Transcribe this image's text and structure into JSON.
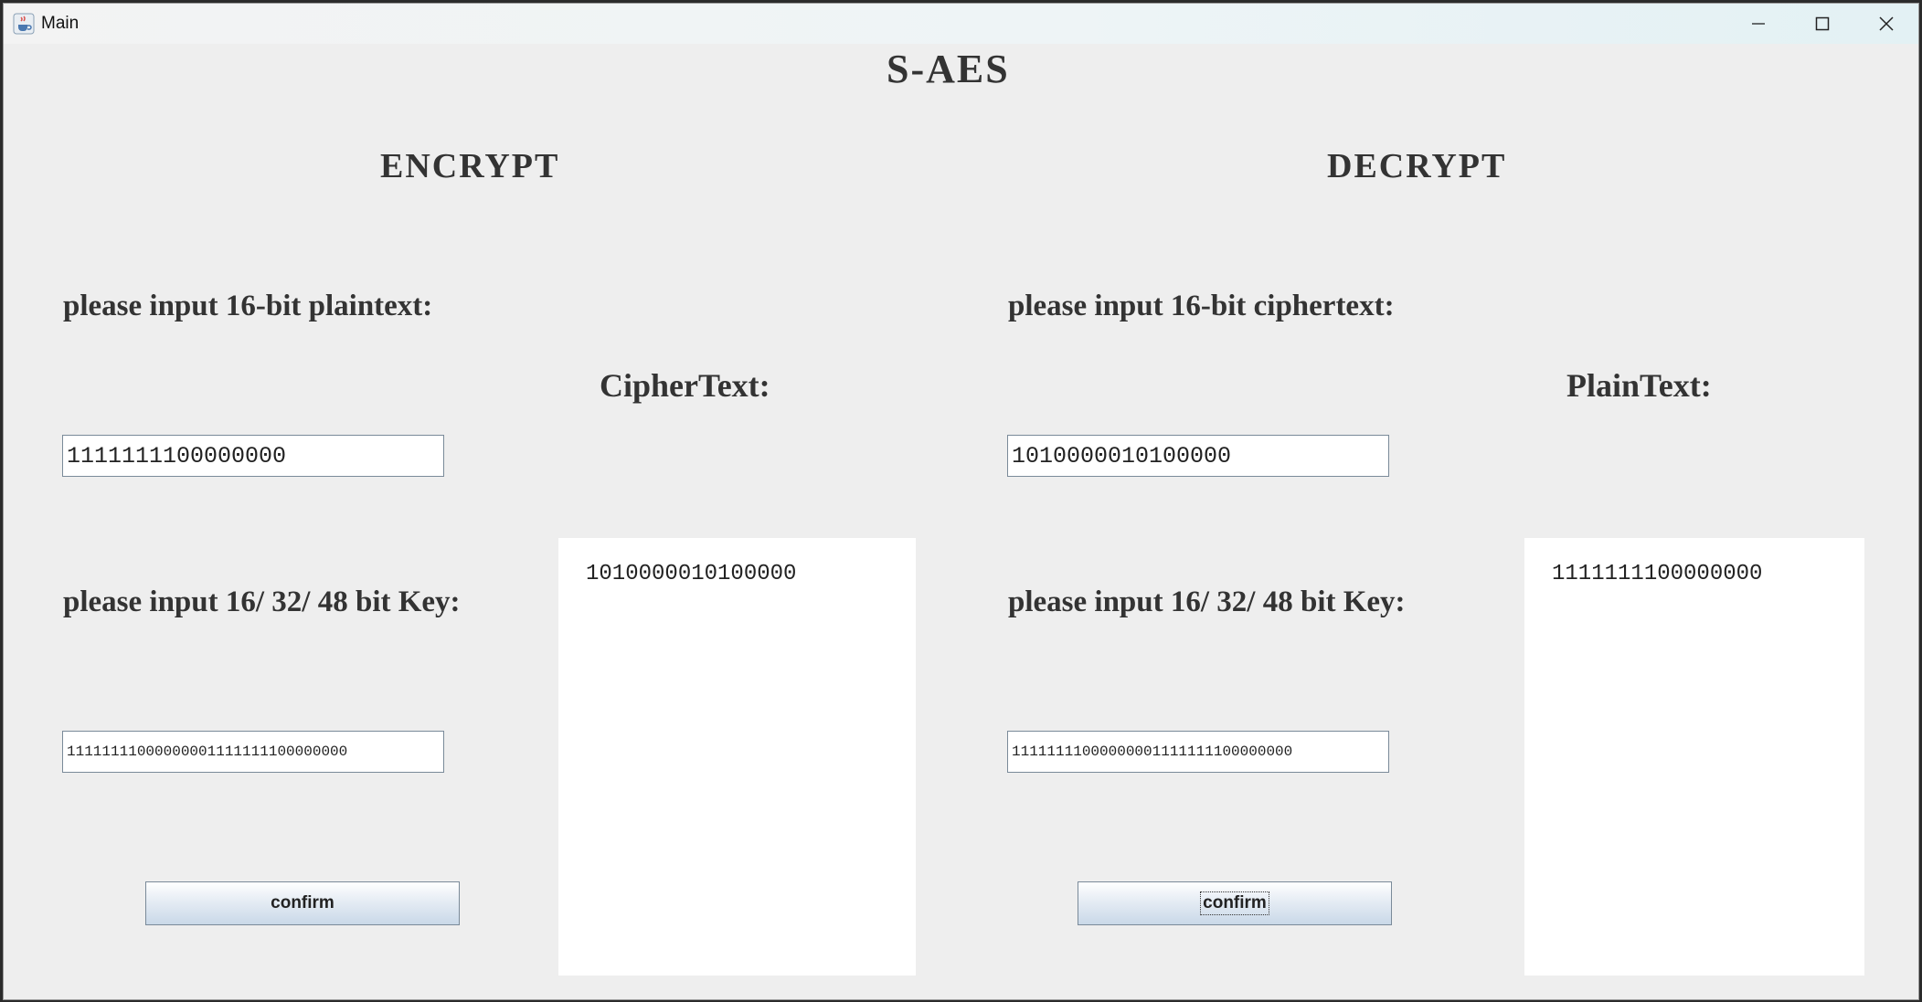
{
  "window": {
    "title": "Main",
    "app_icon": "java-cup-icon",
    "controls": [
      "minimize-icon",
      "maximize-icon",
      "close-icon"
    ]
  },
  "app": {
    "title": "S-AES"
  },
  "encrypt": {
    "heading": "ENCRYPT",
    "plaintext_label": "please input 16-bit plaintext:",
    "plaintext_value": "1111111100000000",
    "key_label": "please input 16/ 32/ 48 bit Key:",
    "key_value": "11111111000000001111111100000000",
    "confirm_label": "confirm",
    "output_label": "CipherText:",
    "output_value": "1010000010100000"
  },
  "decrypt": {
    "heading": "DECRYPT",
    "ciphertext_label": "please input 16-bit ciphertext:",
    "ciphertext_value": "1010000010100000",
    "key_label": "please input 16/ 32/ 48 bit Key:",
    "key_value": "11111111000000001111111100000000",
    "confirm_label": "confirm",
    "output_label": "PlainText:",
    "output_value": "1111111100000000"
  }
}
